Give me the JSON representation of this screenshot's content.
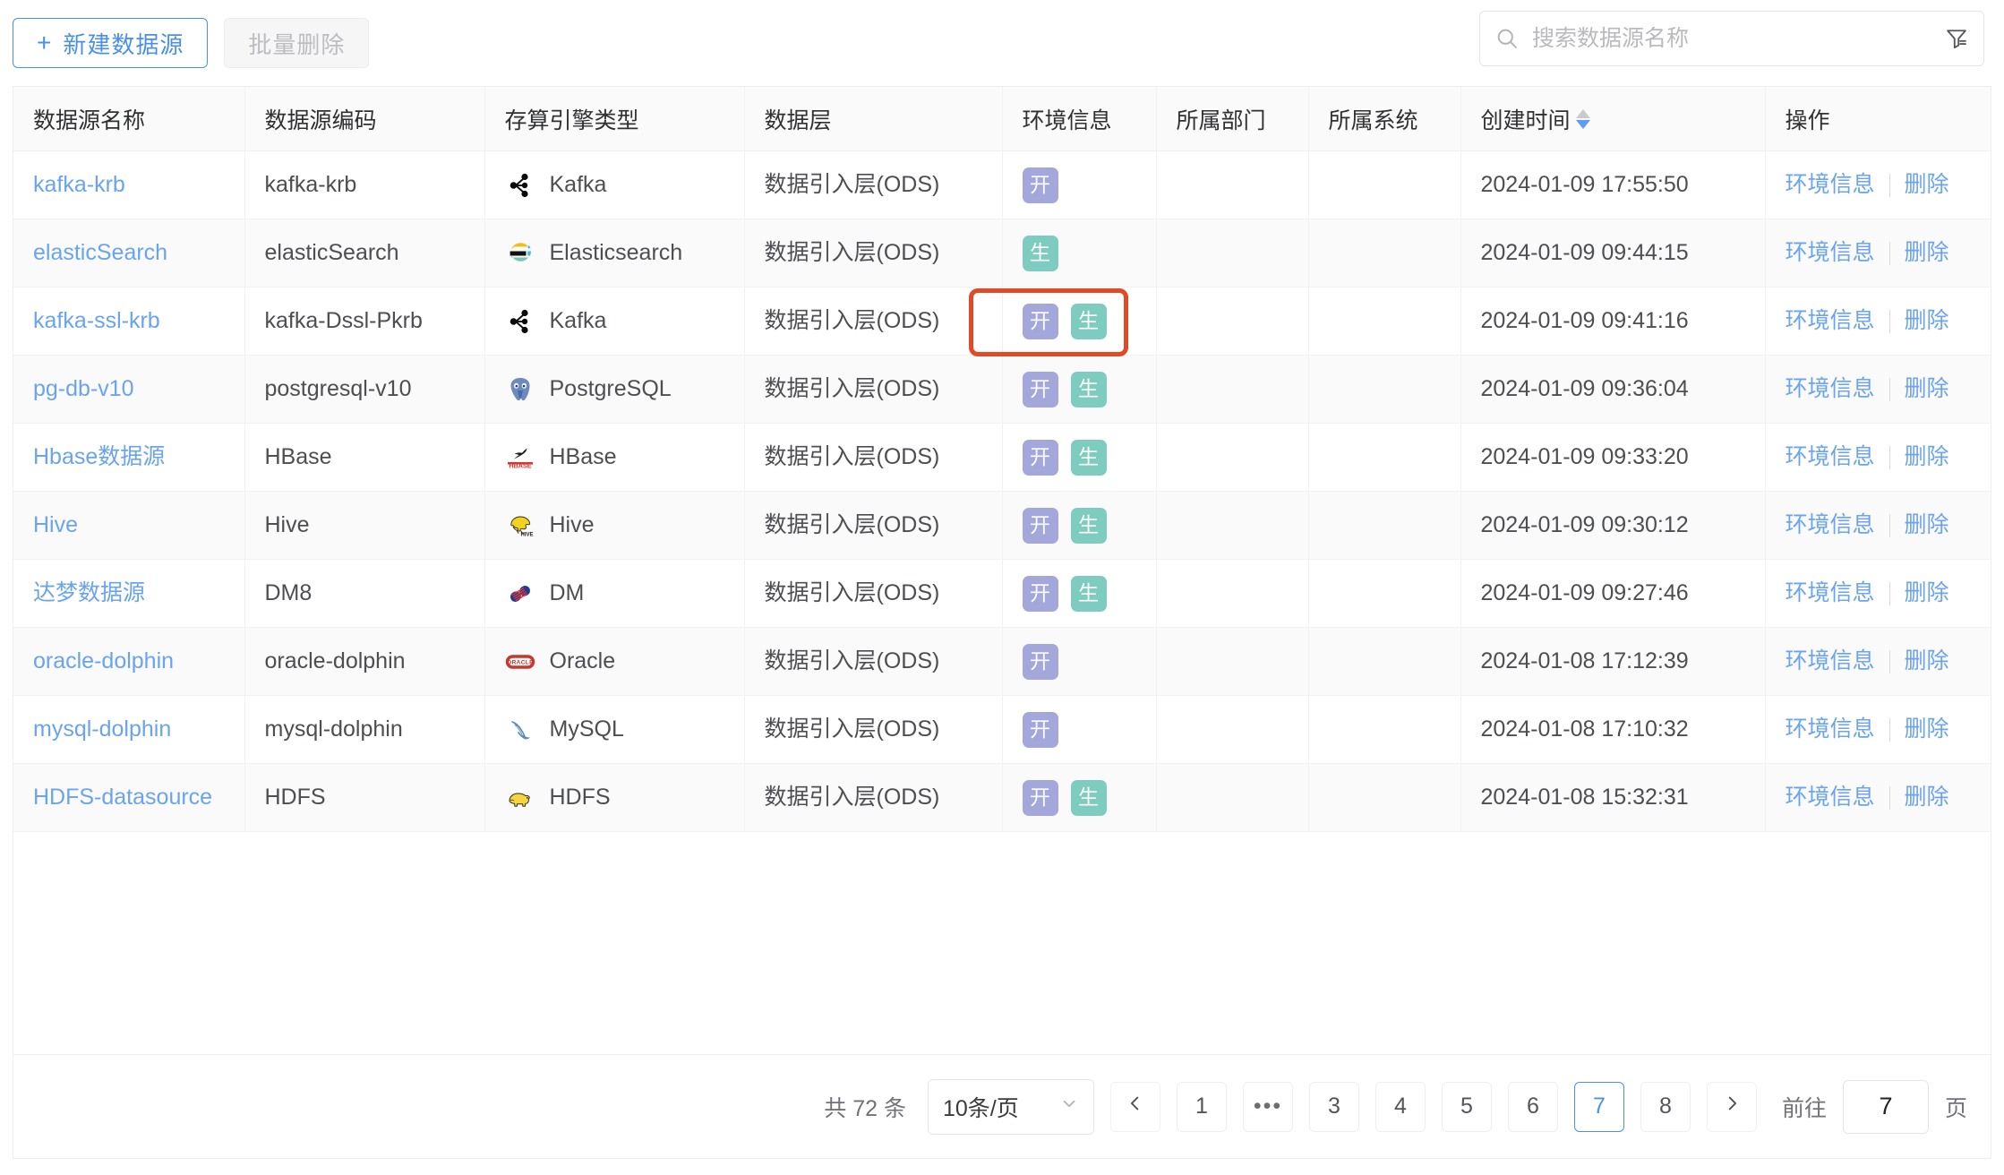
{
  "toolbar": {
    "create_label": "新建数据源",
    "create_plus": "+",
    "batch_delete_label": "批量删除"
  },
  "search": {
    "placeholder": "搜索数据源名称",
    "value": "",
    "search_icon": "search-icon",
    "filter_icon": "filter-icon"
  },
  "table": {
    "columns": [
      {
        "key": "name",
        "label": "数据源名称"
      },
      {
        "key": "code",
        "label": "数据源编码"
      },
      {
        "key": "engine",
        "label": "存算引擎类型"
      },
      {
        "key": "layer",
        "label": "数据层"
      },
      {
        "key": "env",
        "label": "环境信息"
      },
      {
        "key": "dept",
        "label": "所属部门"
      },
      {
        "key": "system",
        "label": "所属系统"
      },
      {
        "key": "time",
        "label": "创建时间",
        "sortable": true,
        "sort_dir": "desc"
      },
      {
        "key": "ops",
        "label": "操作"
      }
    ],
    "rows": [
      {
        "name": "kafka-krb",
        "code": "kafka-krb",
        "engine": "Kafka",
        "engine_icon": "kafka-icon",
        "layer": "数据引入层(ODS)",
        "env": [
          "开"
        ],
        "dept": "",
        "system": "",
        "time": "2024-01-09 17:55:50"
      },
      {
        "name": "elasticSearch",
        "code": "elasticSearch",
        "engine": "Elasticsearch",
        "engine_icon": "elasticsearch-icon",
        "layer": "数据引入层(ODS)",
        "env": [
          "生"
        ],
        "dept": "",
        "system": "",
        "time": "2024-01-09 09:44:15"
      },
      {
        "name": "kafka-ssl-krb",
        "code": "kafka-Dssl-Pkrb",
        "engine": "Kafka",
        "engine_icon": "kafka-icon",
        "layer": "数据引入层(ODS)",
        "env": [
          "开",
          "生"
        ],
        "dept": "",
        "system": "",
        "time": "2024-01-09 09:41:16",
        "highlighted": true
      },
      {
        "name": "pg-db-v10",
        "code": "postgresql-v10",
        "engine": "PostgreSQL",
        "engine_icon": "postgresql-icon",
        "layer": "数据引入层(ODS)",
        "env": [
          "开",
          "生"
        ],
        "dept": "",
        "system": "",
        "time": "2024-01-09 09:36:04"
      },
      {
        "name": "Hbase数据源",
        "code": "HBase",
        "engine": "HBase",
        "engine_icon": "hbase-icon",
        "layer": "数据引入层(ODS)",
        "env": [
          "开",
          "生"
        ],
        "dept": "",
        "system": "",
        "time": "2024-01-09 09:33:20"
      },
      {
        "name": "Hive",
        "code": "Hive",
        "engine": "Hive",
        "engine_icon": "hive-icon",
        "layer": "数据引入层(ODS)",
        "env": [
          "开",
          "生"
        ],
        "dept": "",
        "system": "",
        "time": "2024-01-09 09:30:12"
      },
      {
        "name": "达梦数据源",
        "code": "DM8",
        "engine": "DM",
        "engine_icon": "dm-icon",
        "layer": "数据引入层(ODS)",
        "env": [
          "开",
          "生"
        ],
        "dept": "",
        "system": "",
        "time": "2024-01-09 09:27:46"
      },
      {
        "name": "oracle-dolphin",
        "code": "oracle-dolphin",
        "engine": "Oracle",
        "engine_icon": "oracle-icon",
        "layer": "数据引入层(ODS)",
        "env": [
          "开"
        ],
        "dept": "",
        "system": "",
        "time": "2024-01-08 17:12:39"
      },
      {
        "name": "mysql-dolphin",
        "code": "mysql-dolphin",
        "engine": "MySQL",
        "engine_icon": "mysql-icon",
        "layer": "数据引入层(ODS)",
        "env": [
          "开"
        ],
        "dept": "",
        "system": "",
        "time": "2024-01-08 17:10:32"
      },
      {
        "name": "HDFS-datasource",
        "code": "HDFS",
        "engine": "HDFS",
        "engine_icon": "hadoop-icon",
        "layer": "数据引入层(ODS)",
        "env": [
          "开",
          "生"
        ],
        "dept": "",
        "system": "",
        "time": "2024-01-08 15:32:31"
      }
    ],
    "actions": {
      "env_info_label": "环境信息",
      "delete_label": "删除"
    },
    "env_badge_labels": {
      "dev": "开",
      "prod": "生"
    }
  },
  "pagination": {
    "total_text": "共 72 条",
    "total_count": 72,
    "page_size_label": "10条/页",
    "prev_icon": "chevron-left-icon",
    "next_icon": "chevron-right-icon",
    "items": [
      "1",
      "•••",
      "3",
      "4",
      "5",
      "6",
      "7",
      "8"
    ],
    "current_page": "7",
    "goto_label": "前往",
    "goto_value": "7",
    "page_unit": "页"
  },
  "colors": {
    "accent_blue": "#4a90e8",
    "link_blue": "#6aa3ee",
    "badge_dev": "#a3a7da",
    "badge_prod": "#7ecbbf",
    "highlight_red": "#e04a26"
  }
}
